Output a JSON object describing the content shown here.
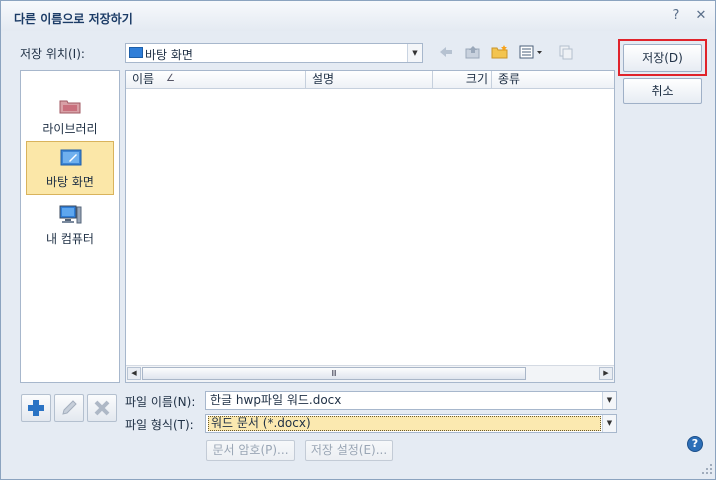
{
  "window": {
    "title": "다른 이름으로 저장하기",
    "help_glyph": "?",
    "close_glyph": "✕"
  },
  "location": {
    "label": "저장 위치(I):",
    "value": "바탕 화면"
  },
  "toolbar": {
    "icons": [
      "back-icon",
      "up-folder-icon",
      "new-folder-icon",
      "view-menu-icon",
      "copy-icon"
    ]
  },
  "places": [
    {
      "label": "라이브러리",
      "icon": "library-icon",
      "active": false
    },
    {
      "label": "바탕 화면",
      "icon": "desktop-icon",
      "active": true
    },
    {
      "label": "내 컴퓨터",
      "icon": "computer-icon",
      "active": false
    }
  ],
  "filelist": {
    "columns": [
      "이름",
      "설명",
      "크기",
      "종류"
    ],
    "sort_glyph": "∠",
    "scroll_glyph": "Ⅲ"
  },
  "filename": {
    "label": "파일 이름(N):",
    "value": "한글 hwp파일 워드.docx"
  },
  "filetype": {
    "label": "파일 형식(T):",
    "value": "워드 문서 (*.docx)"
  },
  "buttons": {
    "save": "저장(D)",
    "cancel": "취소",
    "doc_password": "문서 암호(P)...",
    "save_settings": "저장 설정(E)..."
  },
  "colors": {
    "accent_highlight": "#e0232b",
    "selected_place": "#fbe7a8"
  }
}
